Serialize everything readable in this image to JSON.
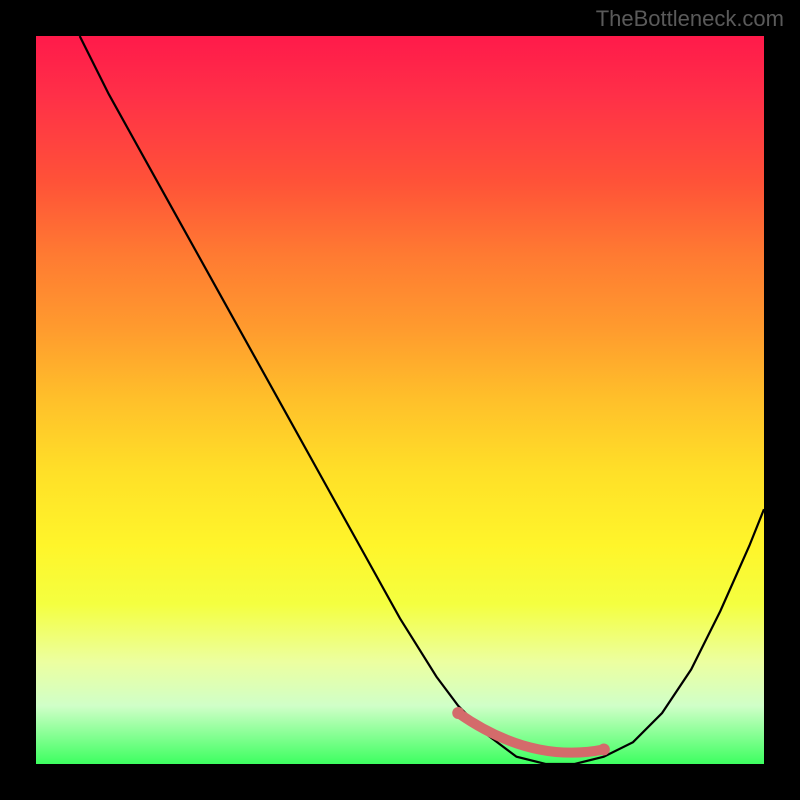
{
  "watermark": "TheBottleneck.com",
  "chart_data": {
    "type": "line",
    "title": "",
    "xlabel": "",
    "ylabel": "",
    "xlim": [
      0,
      100
    ],
    "ylim": [
      0,
      100
    ],
    "grid": false,
    "series": [
      {
        "name": "curve",
        "x": [
          6,
          10,
          15,
          20,
          25,
          30,
          35,
          40,
          45,
          50,
          55,
          58,
          62,
          66,
          70,
          74,
          78,
          82,
          86,
          90,
          94,
          98,
          100
        ],
        "values": [
          100,
          92,
          83,
          74,
          65,
          56,
          47,
          38,
          29,
          20,
          12,
          8,
          4,
          1,
          0,
          0,
          1,
          3,
          7,
          13,
          21,
          30,
          35
        ]
      }
    ],
    "accent_segment": {
      "name": "bottom-highlight",
      "color": "#d46b6b",
      "x": [
        58,
        78
      ],
      "y": [
        7,
        2
      ]
    },
    "background_gradient": {
      "top": "#ff1a4a",
      "mid": "#ffe028",
      "bottom": "#3dff60"
    }
  }
}
